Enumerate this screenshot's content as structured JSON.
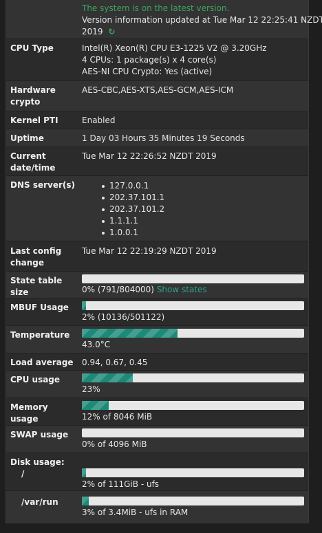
{
  "version": {
    "status": "The system is on the latest version.",
    "updated_line1": "Version information updated at Tue Mar 12 22:25:41 NZDT",
    "updated_line2": "2019",
    "refresh_icon": "refresh-icon"
  },
  "cpu_type": {
    "label": "CPU Type",
    "line1": "Intel(R) Xeon(R) CPU E3-1225 V2 @ 3.20GHz",
    "line2": "4 CPUs: 1 package(s) x 4 core(s)",
    "line3": "AES-NI CPU Crypto: Yes (active)"
  },
  "hardware_crypto": {
    "label_line1": "Hardware",
    "label_line2": "crypto",
    "value": "AES-CBC,AES-XTS,AES-GCM,AES-ICM"
  },
  "kernel_pti": {
    "label": "Kernel PTI",
    "value": "Enabled"
  },
  "uptime": {
    "label": "Uptime",
    "value": "1 Day 03 Hours 35 Minutes 19 Seconds"
  },
  "current_datetime": {
    "label_line1": "Current",
    "label_line2": "date/time",
    "value": "Tue Mar 12 22:26:52 NZDT 2019"
  },
  "dns_servers": {
    "label": "DNS server(s)",
    "items": [
      "127.0.0.1",
      "202.37.101.1",
      "202.37.101.2",
      "1.1.1.1",
      "1.0.0.1"
    ]
  },
  "last_config_change": {
    "label_line1": "Last config",
    "label_line2": "change",
    "value": "Tue Mar 12 22:19:29 NZDT 2019"
  },
  "state_table_size": {
    "label": "State table size",
    "percent": 0,
    "text": "0% (791/804000)",
    "link": "Show states"
  },
  "mbuf_usage": {
    "label": "MBUF Usage",
    "percent": 2,
    "text": "2% (10136/501122)"
  },
  "temperature": {
    "label": "Temperature",
    "percent": 43,
    "text": "43.0°C"
  },
  "load_average": {
    "label": "Load average",
    "value": "0.94, 0.67, 0.45"
  },
  "cpu_usage": {
    "label": "CPU usage",
    "percent": 23,
    "text": "23%"
  },
  "memory_usage": {
    "label": "Memory usage",
    "percent": 12,
    "text": "12% of 8046 MiB"
  },
  "swap_usage": {
    "label": "SWAP usage",
    "percent": 0,
    "text": "0% of 4096 MiB"
  },
  "disk_usage": {
    "label": "Disk usage:",
    "disks": [
      {
        "mount": "/",
        "percent": 2,
        "text": "2% of 111GiB - ufs"
      },
      {
        "mount": "/var/run",
        "percent": 3,
        "text": "3% of 3.4MiB - ufs in RAM"
      }
    ]
  },
  "colors": {
    "accent_green": "#3fa35f",
    "bar_fill": "#1b8a78",
    "bar_track": "#e7e7e7",
    "link": "#2aa38b"
  }
}
